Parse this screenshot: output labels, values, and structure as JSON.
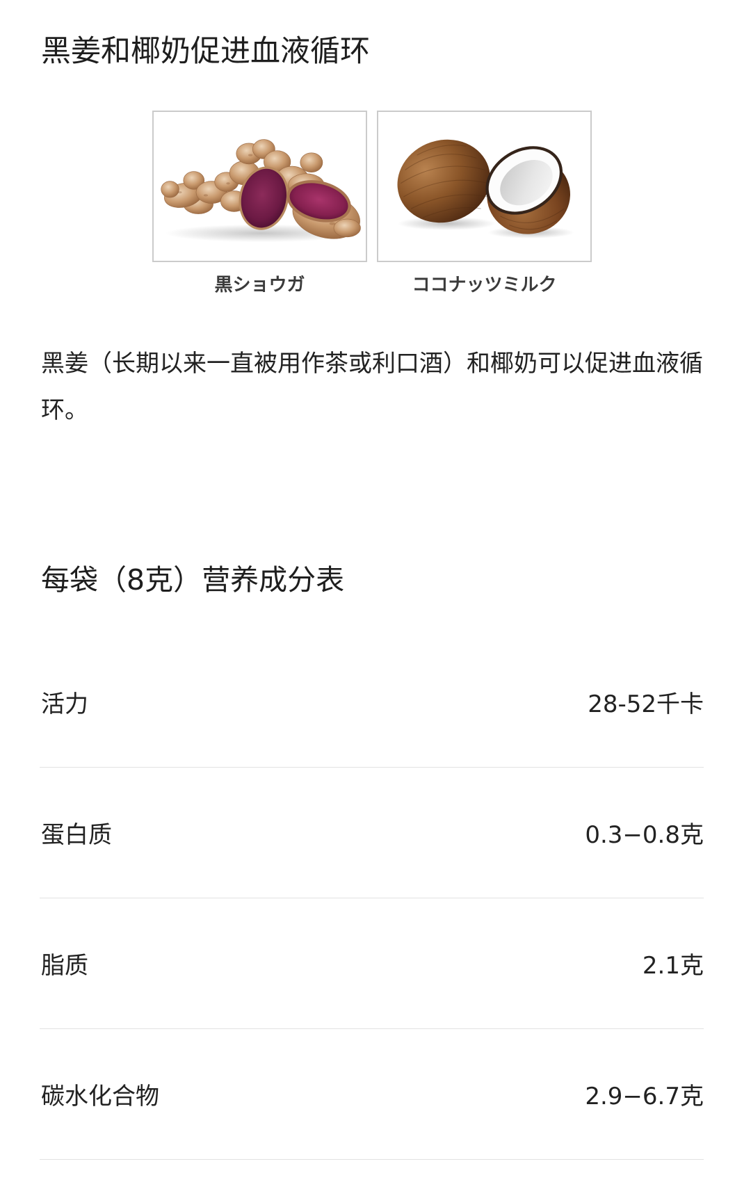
{
  "intro": {
    "title": "黑姜和椰奶促进血液循环",
    "figures": [
      {
        "caption": "黒ショウガ"
      },
      {
        "caption": "ココナッツミルク"
      }
    ],
    "description": "黑姜（长期以来一直被用作茶或利口酒）和椰奶可以促进血液循环。"
  },
  "nutrition": {
    "title": "每袋（8克）营养成分表",
    "rows": [
      {
        "label": "活力",
        "value": "28-52千卡"
      },
      {
        "label": "蛋白质",
        "value": "0.3−0.8克"
      },
      {
        "label": "脂质",
        "value": "2.1克"
      },
      {
        "label": "碳水化合物",
        "value": "2.9−6.7克"
      }
    ]
  },
  "colors": {
    "background": "#ffffff",
    "text": "#222222",
    "caption": "#3b3b3b",
    "image_border": "#cbcbcb",
    "divider": "#e2e2e2"
  }
}
